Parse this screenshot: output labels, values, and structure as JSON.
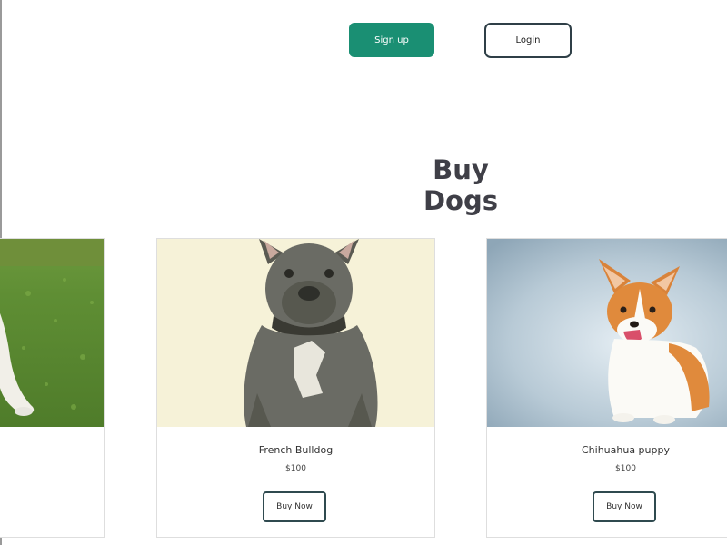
{
  "header": {
    "signup_label": "Sign up",
    "login_label": "Login"
  },
  "section": {
    "title": "Buy Dogs"
  },
  "products": [
    {
      "name": "",
      "price": "",
      "button_label": "",
      "image": "dog-on-grass-photo"
    },
    {
      "name": "French Bulldog",
      "price": "$100",
      "button_label": "Buy Now",
      "image": "french-bulldog-photo"
    },
    {
      "name": "Chihuahua puppy",
      "price": "$100",
      "button_label": "Buy Now",
      "image": "corgi-photo"
    }
  ],
  "colors": {
    "signup_bg": "#1a8f73",
    "button_border": "#2f4a4f",
    "title_text": "#3f3f47"
  }
}
